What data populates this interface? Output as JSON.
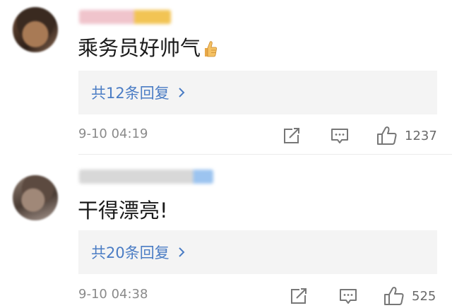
{
  "comments": [
    {
      "text": "乘务员好帅气",
      "emoji": "thumbs-up-icon",
      "reply_summary": "共12条回复",
      "timestamp": "9-10 04:19",
      "likes": "1237"
    },
    {
      "text": "干得漂亮!",
      "reply_summary": "共20条回复",
      "timestamp": "9-10 04:38",
      "likes": "525"
    }
  ],
  "colors": {
    "link": "#4a7cc4",
    "reply_bg": "#f4f4f4",
    "meta_text": "#8a8a8a"
  }
}
